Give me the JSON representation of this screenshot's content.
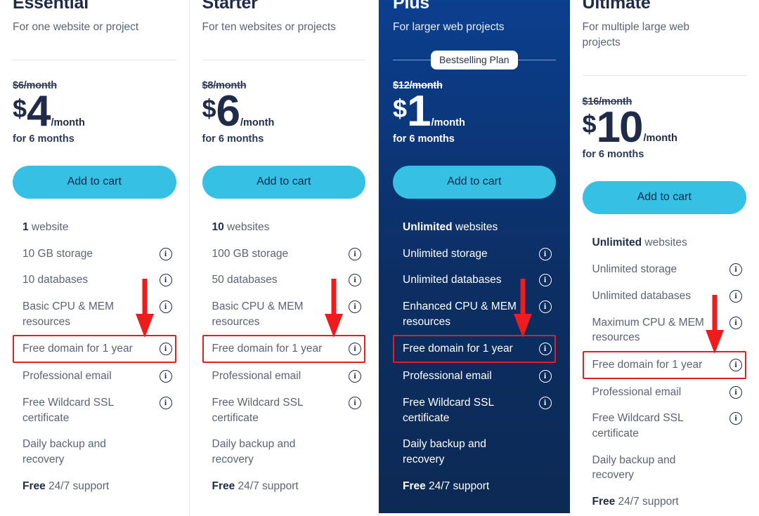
{
  "page": {
    "accent_cyan": "#35c0e4",
    "navy": "#1f2b47",
    "featured_blue": "#0b3f8f",
    "highlight_red": "#e02020"
  },
  "icons": {
    "info": "i",
    "arrow_name": "red-down-arrow-annotation"
  },
  "plans": [
    {
      "id": "essential",
      "title": "Essential",
      "description": "For one website or project",
      "badge": null,
      "old_price": "$6/month",
      "currency": "$",
      "amount": "4",
      "per": "/month",
      "term": "for 6 months",
      "cta": "Add to cart",
      "features": [
        {
          "bold": "1",
          "text": " website",
          "info": false,
          "highlight": false
        },
        {
          "bold": "",
          "text": "10 GB storage",
          "info": true,
          "highlight": false
        },
        {
          "bold": "",
          "text": "10 databases",
          "info": true,
          "highlight": false
        },
        {
          "bold": "",
          "text": "Basic CPU & MEM resources",
          "info": true,
          "highlight": false
        },
        {
          "bold": "",
          "text": "Free domain for 1 year",
          "info": true,
          "highlight": true
        },
        {
          "bold": "",
          "text": "Professional email",
          "info": true,
          "highlight": false
        },
        {
          "bold": "",
          "text": "Free Wildcard SSL certificate",
          "info": true,
          "highlight": false
        },
        {
          "bold": "",
          "text": "Daily backup and recovery",
          "info": false,
          "highlight": false
        },
        {
          "bold": "Free",
          "text": " 24/7 support",
          "info": false,
          "highlight": false
        }
      ]
    },
    {
      "id": "starter",
      "title": "Starter",
      "description": "For ten websites or projects",
      "badge": null,
      "old_price": "$8/month",
      "currency": "$",
      "amount": "6",
      "per": "/month",
      "term": "for 6 months",
      "cta": "Add to cart",
      "features": [
        {
          "bold": "10",
          "text": " websites",
          "info": false,
          "highlight": false
        },
        {
          "bold": "",
          "text": "100 GB storage",
          "info": true,
          "highlight": false
        },
        {
          "bold": "",
          "text": "50 databases",
          "info": true,
          "highlight": false
        },
        {
          "bold": "",
          "text": "Basic CPU & MEM resources",
          "info": true,
          "highlight": false
        },
        {
          "bold": "",
          "text": "Free domain for 1 year",
          "info": true,
          "highlight": true
        },
        {
          "bold": "",
          "text": "Professional email",
          "info": true,
          "highlight": false
        },
        {
          "bold": "",
          "text": "Free Wildcard SSL certificate",
          "info": true,
          "highlight": false
        },
        {
          "bold": "",
          "text": "Daily backup and recovery",
          "info": false,
          "highlight": false
        },
        {
          "bold": "Free",
          "text": " 24/7 support",
          "info": false,
          "highlight": false
        }
      ]
    },
    {
      "id": "plus",
      "title": "Plus",
      "description": "For larger web projects",
      "badge": "Bestselling Plan",
      "old_price": "$12/month",
      "currency": "$",
      "amount": "1",
      "per": "/month",
      "term": "for 6 months",
      "cta": "Add to cart",
      "features": [
        {
          "bold": "Unlimited",
          "text": " websites",
          "info": false,
          "highlight": false
        },
        {
          "bold": "",
          "text": "Unlimited storage",
          "info": true,
          "highlight": false
        },
        {
          "bold": "",
          "text": "Unlimited databases",
          "info": true,
          "highlight": false
        },
        {
          "bold": "",
          "text": "Enhanced CPU & MEM resources",
          "info": true,
          "highlight": false
        },
        {
          "bold": "",
          "text": "Free domain for 1 year",
          "info": true,
          "highlight": true
        },
        {
          "bold": "",
          "text": "Professional email",
          "info": true,
          "highlight": false
        },
        {
          "bold": "",
          "text": "Free Wildcard SSL certificate",
          "info": true,
          "highlight": false
        },
        {
          "bold": "",
          "text": "Daily backup and recovery",
          "info": false,
          "highlight": false
        },
        {
          "bold": "Free",
          "text": " 24/7 support",
          "info": false,
          "highlight": false
        }
      ]
    },
    {
      "id": "ultimate",
      "title": "Ultimate",
      "description": "For multiple large web projects",
      "badge": null,
      "old_price": "$16/month",
      "currency": "$",
      "amount": "10",
      "per": "/month",
      "term": "for 6 months",
      "cta": "Add to cart",
      "features": [
        {
          "bold": "Unlimited",
          "text": " websites",
          "info": false,
          "highlight": false
        },
        {
          "bold": "",
          "text": "Unlimited storage",
          "info": true,
          "highlight": false
        },
        {
          "bold": "",
          "text": "Unlimited databases",
          "info": true,
          "highlight": false
        },
        {
          "bold": "",
          "text": "Maximum CPU & MEM resources",
          "info": true,
          "highlight": false
        },
        {
          "bold": "",
          "text": "Free domain for 1 year",
          "info": true,
          "highlight": true
        },
        {
          "bold": "",
          "text": "Professional email",
          "info": true,
          "highlight": false
        },
        {
          "bold": "",
          "text": "Free Wildcard SSL certificate",
          "info": true,
          "highlight": false
        },
        {
          "bold": "",
          "text": "Daily backup and recovery",
          "info": false,
          "highlight": false
        },
        {
          "bold": "Free",
          "text": " 24/7 support",
          "info": false,
          "highlight": false
        }
      ]
    }
  ]
}
